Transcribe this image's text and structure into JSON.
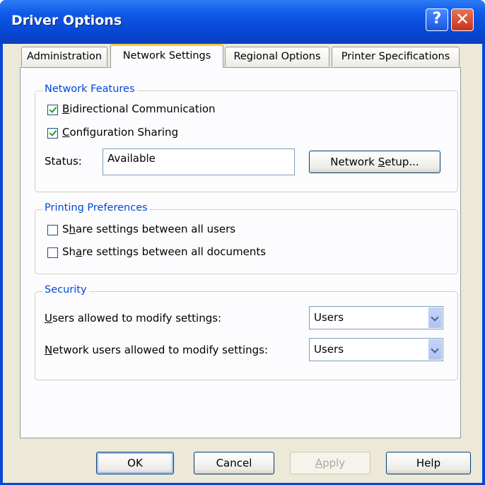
{
  "window": {
    "title": "Driver Options",
    "help_glyph": "?",
    "close_glyph": "✕"
  },
  "tabs": [
    {
      "label": "Administration",
      "active": false
    },
    {
      "label": "Network Settings",
      "active": true
    },
    {
      "label": "Regional Options",
      "active": false
    },
    {
      "label": "Printer Specifications",
      "active": false
    }
  ],
  "network_features": {
    "legend": "Network Features",
    "bidirectional": {
      "label_underline": "B",
      "label_rest": "idirectional Communication",
      "checked": true
    },
    "config_sharing": {
      "label_underline": "C",
      "label_rest": "onfiguration Sharing",
      "checked": true
    },
    "status_label": "Status:",
    "status_value": "Available",
    "setup_pre": "Network ",
    "setup_underline": "S",
    "setup_post": "etup..."
  },
  "printing_preferences": {
    "legend": "Printing Preferences",
    "share_users": {
      "pre": "S",
      "underline": "h",
      "post": "are settings between all users",
      "checked": false
    },
    "share_docs": {
      "pre": "Sh",
      "underline": "a",
      "post": "re settings between all documents",
      "checked": false
    }
  },
  "security": {
    "legend": "Security",
    "users_label_underline": "U",
    "users_label_rest": "sers allowed to modify settings:",
    "users_value": "Users",
    "network_label_underline": "N",
    "network_label_rest": "etwork users allowed to modify settings:",
    "network_value": "Users"
  },
  "buttons": {
    "ok": "OK",
    "cancel": "Cancel",
    "apply_underline": "A",
    "apply_rest": "pply",
    "help": "Help"
  }
}
